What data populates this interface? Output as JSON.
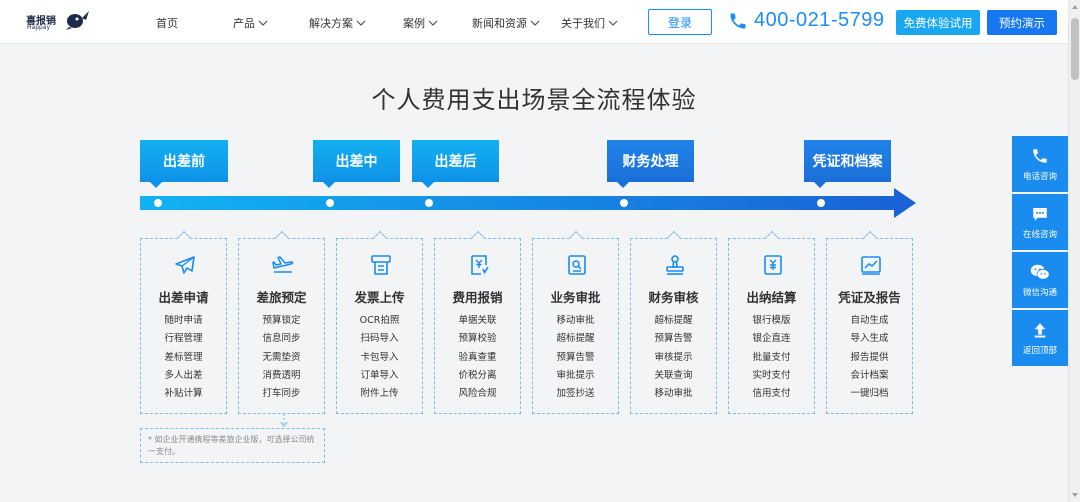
{
  "header": {
    "logo_text": "喜报销",
    "logo_sub": "Happay",
    "nav": [
      {
        "label": "首页",
        "has_dropdown": false
      },
      {
        "label": "产品",
        "has_dropdown": true
      },
      {
        "label": "解决方案",
        "has_dropdown": true
      },
      {
        "label": "案例",
        "has_dropdown": true
      },
      {
        "label": "新闻和资源",
        "has_dropdown": true
      },
      {
        "label": "关于我们",
        "has_dropdown": true
      }
    ],
    "login_label": "登录",
    "phone_icon": "phone-icon",
    "phone_number": "400-021-5799",
    "trial_label": "免费体验试用",
    "demo_label": "预约演示"
  },
  "main": {
    "title": "个人费用支出场景全流程体验",
    "stages": [
      {
        "label": "出差前"
      },
      {
        "label": "出差中"
      },
      {
        "label": "出差后"
      },
      {
        "label": "财务处理"
      },
      {
        "label": "凭证和档案"
      }
    ],
    "cards": [
      {
        "icon": "airplane-icon",
        "title": "出差申请",
        "items": [
          "随时申请",
          "行程管理",
          "差标管理",
          "多人出差",
          "补贴计算"
        ]
      },
      {
        "icon": "flight-landing-icon",
        "title": "差旅预定",
        "items": [
          "预算锁定",
          "信息同步",
          "无需垫资",
          "消费透明",
          "打车同步"
        ]
      },
      {
        "icon": "receipt-upload-icon",
        "title": "发票上传",
        "items": [
          "OCR拍照",
          "扫码导入",
          "卡包导入",
          "订单导入",
          "附件上传"
        ]
      },
      {
        "icon": "expense-report-icon",
        "title": "费用报销",
        "items": [
          "单据关联",
          "预算校验",
          "验真查重",
          "价税分离",
          "风险合规"
        ]
      },
      {
        "icon": "approval-icon",
        "title": "业务审批",
        "items": [
          "移动审批",
          "超标提醒",
          "预算告警",
          "审批提示",
          "加签抄送"
        ]
      },
      {
        "icon": "stamp-icon",
        "title": "财务审核",
        "items": [
          "超标提醒",
          "预算告警",
          "审核提示",
          "关联查询",
          "移动审批"
        ]
      },
      {
        "icon": "payment-icon",
        "title": "出纳结算",
        "items": [
          "银行模版",
          "银企直连",
          "批量支付",
          "实时支付",
          "信用支付"
        ]
      },
      {
        "icon": "report-icon",
        "title": "凭证及报告",
        "items": [
          "自动生成",
          "导入生成",
          "报告提供",
          "会计档案",
          "一键归档"
        ]
      }
    ],
    "note": "* 如企业开通携程等差旅企业版，可选择公司统一支付。"
  },
  "float_bar": [
    {
      "icon": "phone-icon",
      "label": "电话咨询"
    },
    {
      "icon": "chat-icon",
      "label": "在线咨询"
    },
    {
      "icon": "wechat-icon",
      "label": "微信沟通"
    },
    {
      "icon": "back-to-top-icon",
      "label": "返回顶部"
    }
  ],
  "colors": {
    "primary": "#1a8cff",
    "stage_light": "#14b0f0",
    "stage_dark": "#1a6fd8",
    "background": "#f3f4f6",
    "card_border": "#7cbcf2"
  }
}
